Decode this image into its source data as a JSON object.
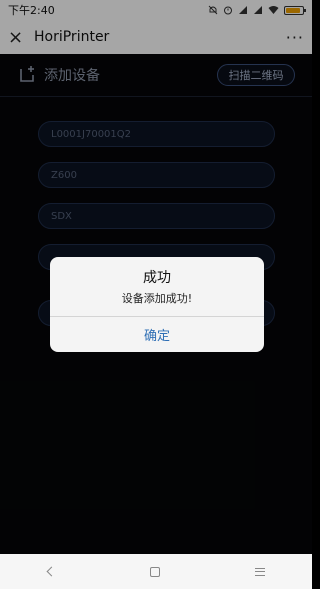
{
  "status_bar": {
    "time": "下午2:40",
    "icons": [
      "mute-bell-icon",
      "alarm-icon",
      "signal-icon",
      "signal-icon",
      "wifi-icon",
      "battery-icon"
    ],
    "battery_level": 0.85,
    "battery_color": "#f0a000"
  },
  "nav": {
    "close_icon": "×",
    "title": "HoriPrinter",
    "more_icon": "···"
  },
  "page": {
    "title": "添加设备",
    "scan_button": "扫描二维码",
    "fields": [
      {
        "value": "L0001J70001Q2"
      },
      {
        "value": "Z600"
      },
      {
        "value": "SDX"
      }
    ]
  },
  "dialog": {
    "title": "成功",
    "message": "设备添加成功!",
    "confirm": "确定",
    "accent": "#2f6fb5"
  }
}
